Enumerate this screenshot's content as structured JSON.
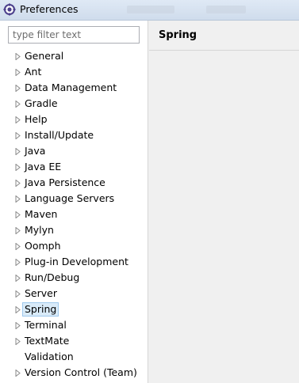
{
  "window": {
    "title": "Preferences",
    "icon": "preferences-gear-icon"
  },
  "filter": {
    "placeholder": "type filter text",
    "value": ""
  },
  "tree": {
    "items": [
      {
        "label": "General",
        "expandable": true
      },
      {
        "label": "Ant",
        "expandable": true
      },
      {
        "label": "Data Management",
        "expandable": true
      },
      {
        "label": "Gradle",
        "expandable": true
      },
      {
        "label": "Help",
        "expandable": true
      },
      {
        "label": "Install/Update",
        "expandable": true
      },
      {
        "label": "Java",
        "expandable": true
      },
      {
        "label": "Java EE",
        "expandable": true
      },
      {
        "label": "Java Persistence",
        "expandable": true
      },
      {
        "label": "Language Servers",
        "expandable": true
      },
      {
        "label": "Maven",
        "expandable": true
      },
      {
        "label": "Mylyn",
        "expandable": true
      },
      {
        "label": "Oomph",
        "expandable": true
      },
      {
        "label": "Plug-in Development",
        "expandable": true
      },
      {
        "label": "Run/Debug",
        "expandable": true
      },
      {
        "label": "Server",
        "expandable": true
      },
      {
        "label": "Spring",
        "expandable": true,
        "selected": true
      },
      {
        "label": "Terminal",
        "expandable": true
      },
      {
        "label": "TextMate",
        "expandable": true
      },
      {
        "label": "Validation",
        "expandable": false
      },
      {
        "label": "Version Control (Team)",
        "expandable": true
      }
    ]
  },
  "page": {
    "title": "Spring"
  },
  "colors": {
    "selection_bg": "#d9ebf9",
    "selection_border": "#9fc8ec",
    "pane_bg": "#f0f0f0"
  }
}
